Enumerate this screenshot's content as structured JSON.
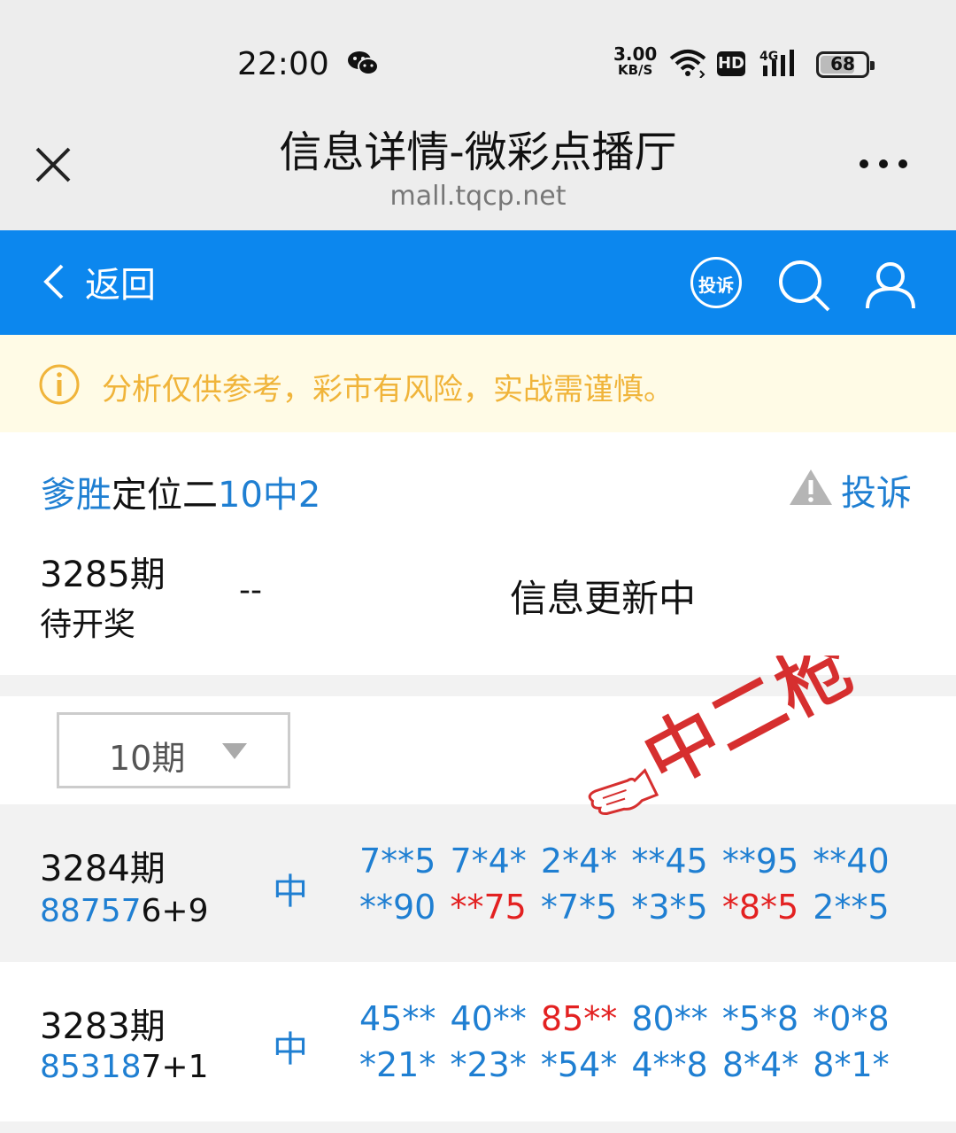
{
  "status_bar": {
    "time": "22:00",
    "net_speed_value": "3.00",
    "net_speed_unit": "KB/S",
    "hd_label": "HD",
    "network_label": "4G",
    "battery": "68"
  },
  "webview": {
    "title": "信息详情-微彩点播厅",
    "url": "mall.tqcp.net"
  },
  "nav": {
    "back_label": "返回",
    "complain_badge": "投诉"
  },
  "notice": {
    "text": "分析仅供参考，彩市有风险，实战需谨慎。"
  },
  "plan": {
    "author": "爹胜",
    "type": "定位二",
    "record": "10中2",
    "complain_label": "投诉"
  },
  "pending": {
    "issue": "3285期",
    "status": "待开奖",
    "dash": "--",
    "update": "信息更新中"
  },
  "filter": {
    "selected": "10期"
  },
  "stamp": {
    "text": "中二枪"
  },
  "history": [
    {
      "issue": "3284期",
      "draw_highlight": "88757",
      "draw_rest": "6+9",
      "result": "中",
      "picks": [
        {
          "t": "7**5",
          "hit": false
        },
        {
          "t": "7*4*",
          "hit": false
        },
        {
          "t": "2*4*",
          "hit": false
        },
        {
          "t": "**45",
          "hit": false
        },
        {
          "t": "**95",
          "hit": false
        },
        {
          "t": "**40",
          "hit": false
        },
        {
          "t": "**90",
          "hit": false
        },
        {
          "t": "**75",
          "hit": true
        },
        {
          "t": "*7*5",
          "hit": false
        },
        {
          "t": "*3*5",
          "hit": false
        },
        {
          "t": "*8*5",
          "hit": true
        },
        {
          "t": "2**5",
          "hit": false
        }
      ]
    },
    {
      "issue": "3283期",
      "draw_highlight": "85318",
      "draw_rest": "7+1",
      "result": "中",
      "picks": [
        {
          "t": "45**",
          "hit": false
        },
        {
          "t": "40**",
          "hit": false
        },
        {
          "t": "85**",
          "hit": true
        },
        {
          "t": "80**",
          "hit": false
        },
        {
          "t": "*5*8",
          "hit": false
        },
        {
          "t": "*0*8",
          "hit": false
        },
        {
          "t": "*21*",
          "hit": false
        },
        {
          "t": "*23*",
          "hit": false
        },
        {
          "t": "*54*",
          "hit": false
        },
        {
          "t": "4**8",
          "hit": false
        },
        {
          "t": "8*4*",
          "hit": false
        },
        {
          "t": "8*1*",
          "hit": false
        }
      ]
    }
  ],
  "colors": {
    "nav_blue": "#0c87ee",
    "link_blue": "#1f7fd2",
    "hit_red": "#e32121",
    "notice_text": "#f0b43a",
    "notice_bg": "#fffbe6"
  }
}
